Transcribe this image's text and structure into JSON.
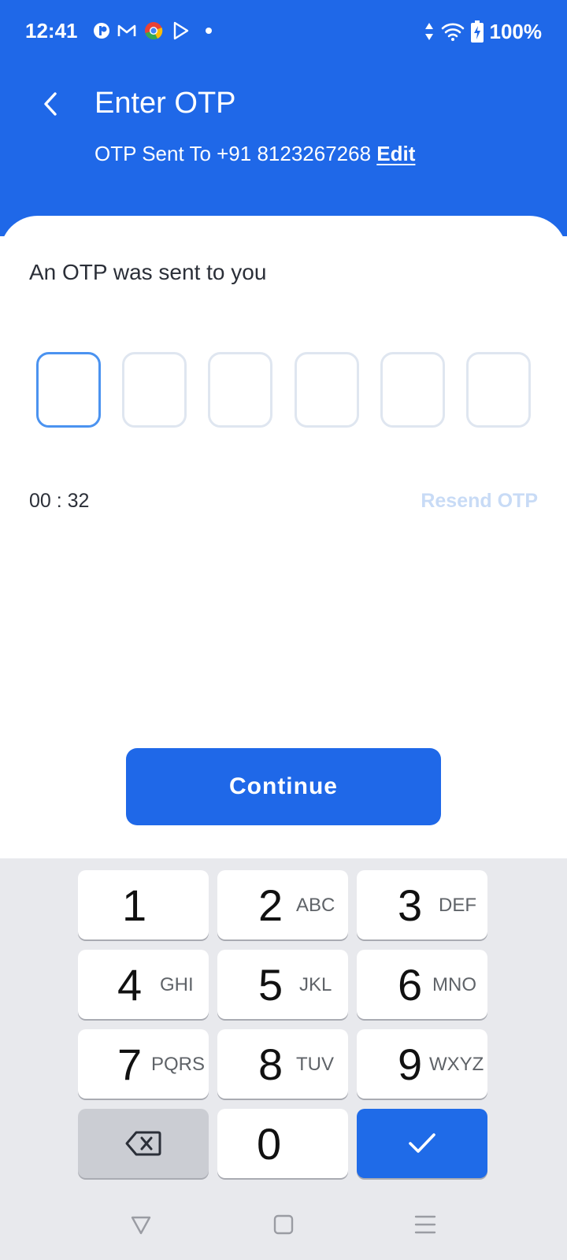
{
  "status_bar": {
    "time": "12:41",
    "battery": "100%",
    "notification_icons": [
      "app-icon",
      "gmail-icon",
      "chrome-icon",
      "play-store-icon",
      "dot-icon"
    ],
    "system_icons": [
      "data-arrows-icon",
      "wifi-icon",
      "battery-charging-icon"
    ]
  },
  "header": {
    "title": "Enter OTP",
    "subtitle_prefix": "OTP Sent To +91 8123267268",
    "edit_label": "Edit",
    "background": "#1f68e8"
  },
  "main": {
    "prompt": "An OTP was sent to you",
    "otp_digits": [
      "",
      "",
      "",
      "",
      "",
      ""
    ],
    "timer": "00 : 32",
    "resend_label": "Resend OTP",
    "continue_label": "Continue"
  },
  "keyboard": {
    "keys": [
      {
        "num": "1",
        "letters": ""
      },
      {
        "num": "2",
        "letters": "ABC"
      },
      {
        "num": "3",
        "letters": "DEF"
      },
      {
        "num": "4",
        "letters": "GHI"
      },
      {
        "num": "5",
        "letters": "JKL"
      },
      {
        "num": "6",
        "letters": "MNO"
      },
      {
        "num": "7",
        "letters": "PQRS"
      },
      {
        "num": "8",
        "letters": "TUV"
      },
      {
        "num": "9",
        "letters": "WXYZ"
      },
      {
        "num": "0",
        "letters": ""
      }
    ],
    "accent": "#1f6be8"
  }
}
